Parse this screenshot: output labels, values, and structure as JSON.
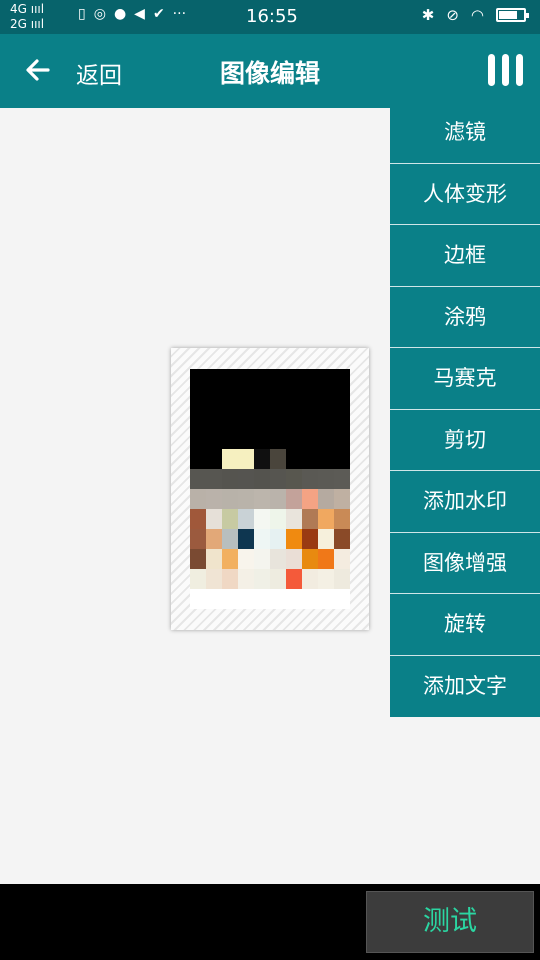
{
  "status_bar": {
    "network_top": "4G",
    "network_bottom": "2G",
    "time": "16:55",
    "notification_icons": [
      "sim-icon",
      "weibo-icon",
      "message-icon",
      "volume-icon",
      "check-icon",
      "more-dots-icon"
    ],
    "right_icons": [
      "bluetooth-icon",
      "mute-icon",
      "wifi-icon",
      "battery-icon"
    ],
    "dots": "···"
  },
  "header": {
    "back_label": "返回",
    "title": "图像编辑"
  },
  "menu": {
    "items": [
      "滤镜",
      "人体变形",
      "边框",
      "涂鸦",
      "马赛克",
      "剪切",
      "添加水印",
      "图像增强",
      "旋转",
      "添加文字"
    ]
  },
  "footer": {
    "test_button": "测试"
  },
  "colors": {
    "accent": "#0a8088",
    "status_bar": "#07636b",
    "button_text": "#2bd6a2"
  }
}
